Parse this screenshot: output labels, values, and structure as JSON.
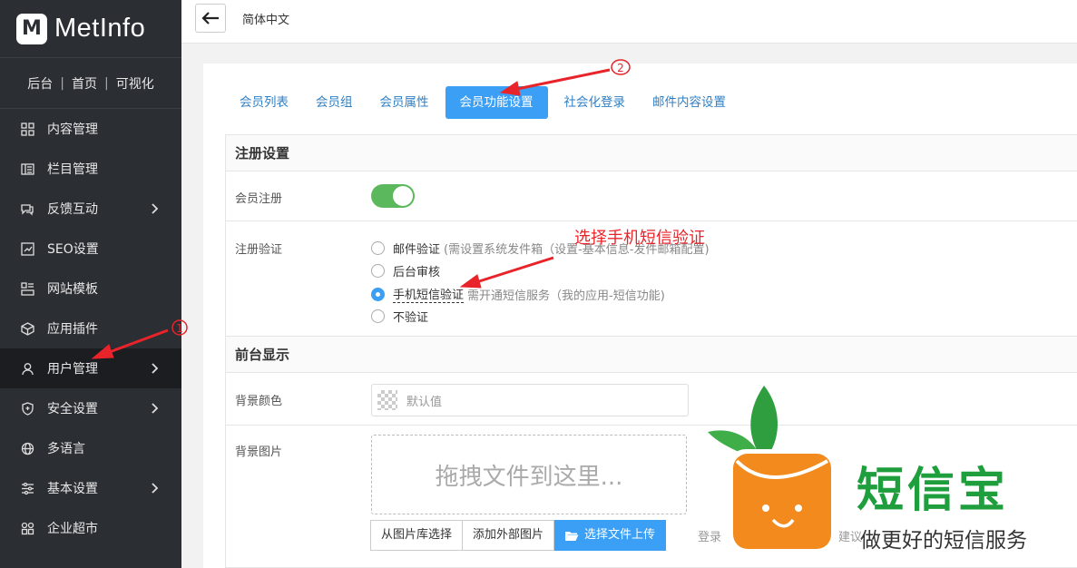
{
  "brand": {
    "logo_letter": "M",
    "name": "MetInfo"
  },
  "toplinks": [
    "后台",
    "首页",
    "可视化"
  ],
  "sidebar": {
    "items": [
      {
        "label": "内容管理",
        "icon": "grid-icon",
        "has_arrow": false
      },
      {
        "label": "栏目管理",
        "icon": "columns-icon",
        "has_arrow": false
      },
      {
        "label": "反馈互动",
        "icon": "chat-icon",
        "has_arrow": true
      },
      {
        "label": "SEO设置",
        "icon": "seo-icon",
        "has_arrow": false
      },
      {
        "label": "网站模板",
        "icon": "template-icon",
        "has_arrow": false
      },
      {
        "label": "应用插件",
        "icon": "cube-icon",
        "has_arrow": false
      },
      {
        "label": "用户管理",
        "icon": "user-icon",
        "has_arrow": true,
        "active": true
      },
      {
        "label": "安全设置",
        "icon": "shield-icon",
        "has_arrow": true
      },
      {
        "label": "多语言",
        "icon": "globe-icon",
        "has_arrow": false
      },
      {
        "label": "基本设置",
        "icon": "sliders-icon",
        "has_arrow": true
      },
      {
        "label": "企业超市",
        "icon": "shop-icon",
        "has_arrow": false
      }
    ]
  },
  "topbar": {
    "language": "简体中文"
  },
  "tabs": [
    {
      "label": "会员列表"
    },
    {
      "label": "会员组"
    },
    {
      "label": "会员属性"
    },
    {
      "label": "会员功能设置",
      "active": true
    },
    {
      "label": "社会化登录"
    },
    {
      "label": "邮件内容设置"
    }
  ],
  "register_section": {
    "title": "注册设置",
    "member_register_label": "会员注册",
    "member_register_enabled": true,
    "verify_label": "注册验证",
    "verify_options": [
      {
        "label": "邮件验证",
        "hint": "(需设置系统发件箱（设置-基本信息-发件邮箱配置)",
        "checked": false
      },
      {
        "label": "后台审核",
        "hint": "",
        "checked": false
      },
      {
        "label": "手机短信验证",
        "hint": "需开通短信服务（我的应用-短信功能)",
        "checked": true
      },
      {
        "label": "不验证",
        "hint": "",
        "checked": false
      }
    ]
  },
  "front_section": {
    "title": "前台显示",
    "bg_color_label": "背景颜色",
    "bg_color_value": "默认值",
    "bg_image_label": "背景图片",
    "dropzone_text": "拖拽文件到这里...",
    "btn_library": "从图片库选择",
    "btn_external": "添加外部图片",
    "btn_upload": "选择文件上传",
    "upload_hint_left": "登录",
    "upload_hint_right": "建议"
  },
  "annotations": {
    "select_sms": "选择手机短信验证",
    "marker_1": "1",
    "marker_2": "2"
  },
  "watermark": {
    "title": "短信宝",
    "subtitle": "做更好的短信服务"
  },
  "colors": {
    "sidebar_bg": "#2b2e33",
    "accent": "#3a9ff5",
    "toggle_on": "#5cb85c",
    "annot_red": "#e8242a",
    "wm_green": "#1e9e3c",
    "wm_orange": "#f28a1e"
  }
}
